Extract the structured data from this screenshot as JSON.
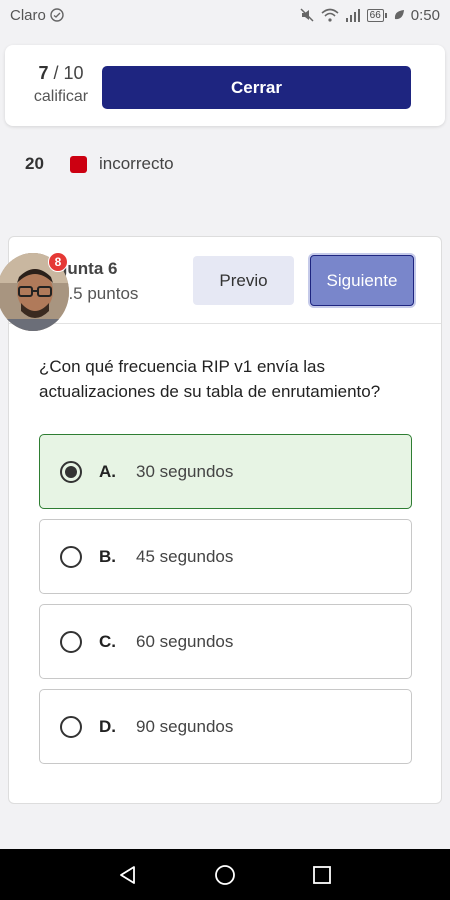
{
  "status_bar": {
    "carrier": "Claro",
    "battery": "66",
    "time": "0:50"
  },
  "score": {
    "current": "7",
    "separator": " / ",
    "total": "10",
    "label": "calificar"
  },
  "header": {
    "close_label": "Cerrar"
  },
  "legend": {
    "count": "20",
    "label": "incorrecto",
    "color": "#cc0011"
  },
  "question": {
    "title": "gunta 6",
    "points": "0.5 puntos",
    "prev_label": "Previo",
    "next_label": "Siguiente",
    "text": "¿Con qué frecuencia RIP v1 envía las actualizaciones de su tabla de enrutamiento?",
    "options": [
      {
        "letter": "A.",
        "text": "30 segundos",
        "selected": true
      },
      {
        "letter": "B.",
        "text": "45 segundos",
        "selected": false
      },
      {
        "letter": "C.",
        "text": "60 segundos",
        "selected": false
      },
      {
        "letter": "D.",
        "text": "90 segundos",
        "selected": false
      }
    ]
  },
  "avatar": {
    "badge_count": "8"
  },
  "colors": {
    "primary": "#1e2580",
    "next_button": "#7986cb",
    "selected_bg": "#e7f4e4",
    "selected_border": "#2e7d32",
    "badge": "#e53935"
  },
  "icons": {
    "status_left": "sync-icon",
    "status_right": [
      "mute-icon",
      "wifi-icon",
      "signal-icon",
      "battery-icon",
      "leaf-icon"
    ],
    "nav": [
      "back-icon",
      "home-icon",
      "recents-icon"
    ]
  }
}
